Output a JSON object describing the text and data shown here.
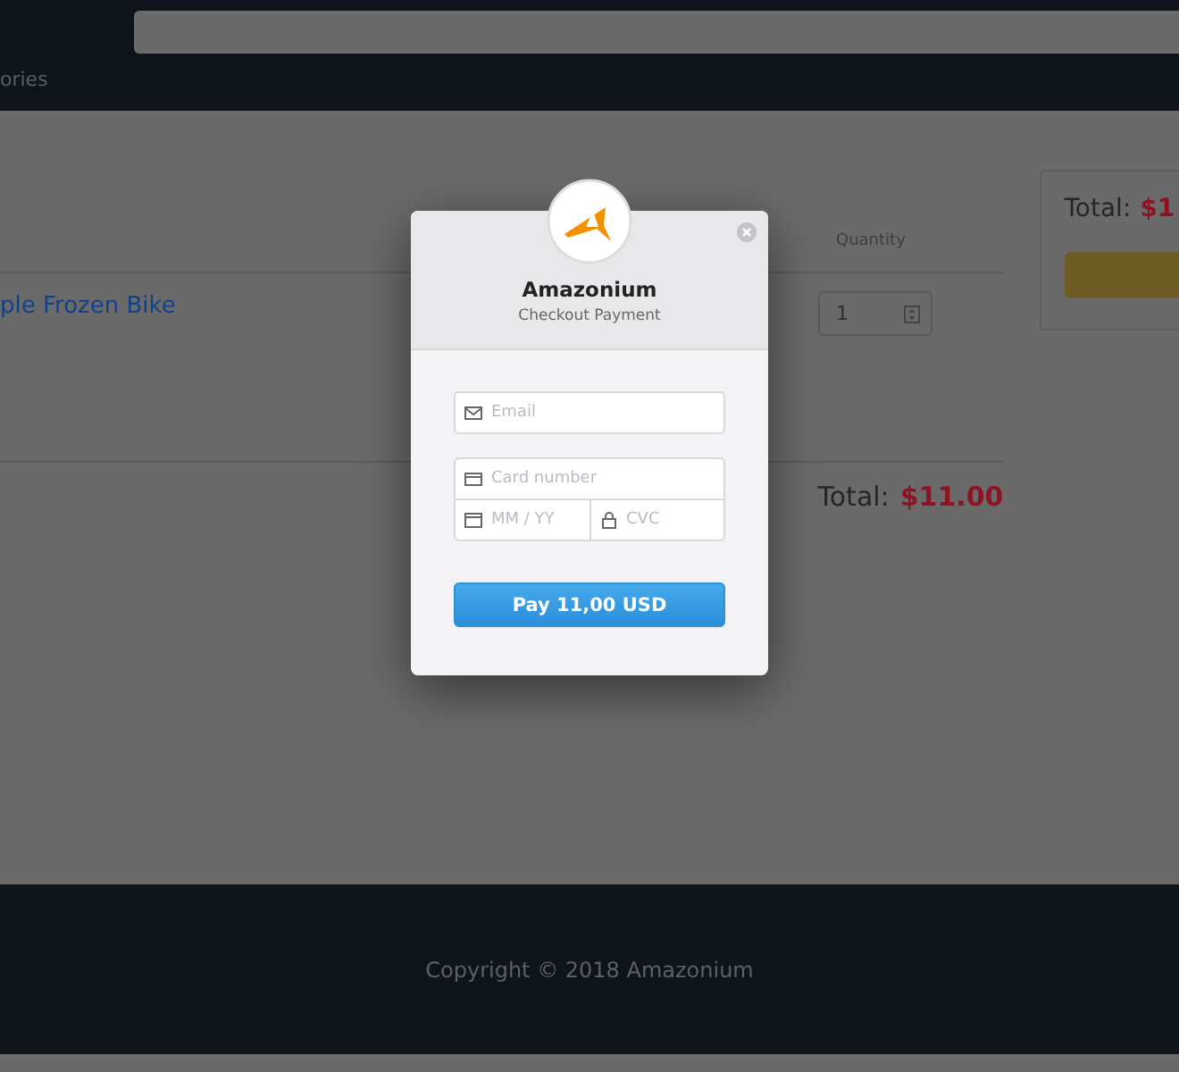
{
  "header": {
    "nav_text": "ories"
  },
  "cart": {
    "columns": [
      {
        "label": "Quantity"
      }
    ],
    "rows": [
      {
        "product": "ple Frozen Bike",
        "quantity": "1"
      }
    ],
    "total_label": "Total:",
    "total_value": "$11.00"
  },
  "summary": {
    "total_label": "Total:",
    "total_value": "$1"
  },
  "modal": {
    "title": "Amazonium",
    "subtitle": "Checkout Payment",
    "fields": [
      {
        "kind": "email",
        "placeholder": "Email"
      },
      {
        "kind": "card",
        "placeholder": "Card number"
      },
      {
        "kind": "date",
        "placeholder": "MM / YY"
      },
      {
        "kind": "cvc",
        "placeholder": "CVC"
      }
    ],
    "pay_button": "Pay 11,00 USD"
  },
  "footer": {
    "copyright": "Copyright © 2018 Amazonium"
  }
}
